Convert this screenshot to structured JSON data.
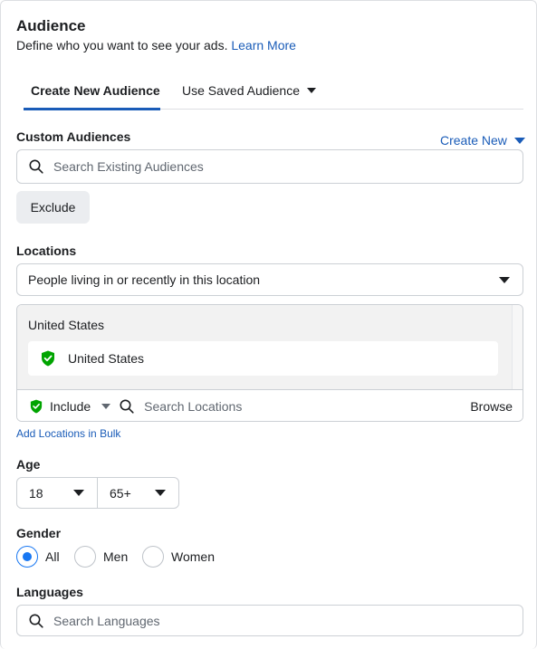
{
  "header": {
    "title": "Audience",
    "subtitle": "Define who you want to see your ads.",
    "learn_more": "Learn More"
  },
  "tabs": [
    {
      "label": "Create New Audience",
      "active": true
    },
    {
      "label": "Use Saved Audience",
      "active": false
    }
  ],
  "custom_audiences": {
    "label": "Custom Audiences",
    "create_new": "Create New",
    "search_placeholder": "Search Existing Audiences",
    "exclude_label": "Exclude"
  },
  "locations": {
    "label": "Locations",
    "type_value": "People living in or recently in this location",
    "group_header": "United States",
    "selected_items": [
      "United States"
    ],
    "include_label": "Include",
    "search_placeholder": "Search Locations",
    "browse_label": "Browse",
    "bulk_link": "Add Locations in Bulk"
  },
  "age": {
    "label": "Age",
    "min": "18",
    "max": "65+"
  },
  "gender": {
    "label": "Gender",
    "options": [
      "All",
      "Men",
      "Women"
    ],
    "selected": "All"
  },
  "languages": {
    "label": "Languages",
    "search_placeholder": "Search Languages"
  },
  "colors": {
    "accent": "#1a5cb8",
    "radio": "#1877f2",
    "include_green": "#00a400"
  }
}
